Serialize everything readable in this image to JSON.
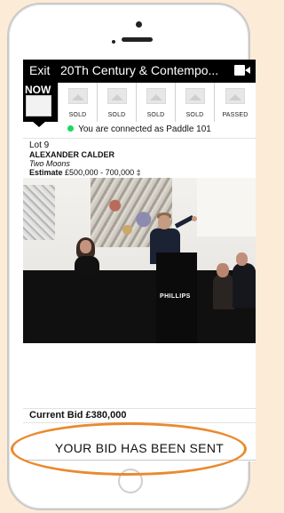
{
  "header": {
    "exit_label": "Exit",
    "title": "20Th Century & Contempo..."
  },
  "icons": {
    "video": "video-camera-icon",
    "thumb": "image-placeholder-icon",
    "connected": "green-dot-icon"
  },
  "lot_strip": {
    "now_label": "NOW",
    "items": [
      {
        "status": "SOLD"
      },
      {
        "status": "SOLD"
      },
      {
        "status": "SOLD"
      },
      {
        "status": "SOLD"
      },
      {
        "status": "PASSED"
      }
    ]
  },
  "connection": {
    "message": "You are connected as Paddle 101"
  },
  "lot": {
    "number": "Lot 9",
    "artist": "ALEXANDER CALDER",
    "work": "Two Moons",
    "estimate_label": "Estimate",
    "estimate_value": "£500,000 - 700,000 ‡"
  },
  "photo": {
    "podium_text": "PHILLIPS"
  },
  "bidding": {
    "current_bid": "Current Bid £380,000",
    "status": "YOUR BID HAS BEEN SENT"
  },
  "colors": {
    "background": "#fcebd6",
    "accent_oval": "#ea8a2e",
    "connected_dot": "#1ed760",
    "header_bg": "#000000"
  }
}
